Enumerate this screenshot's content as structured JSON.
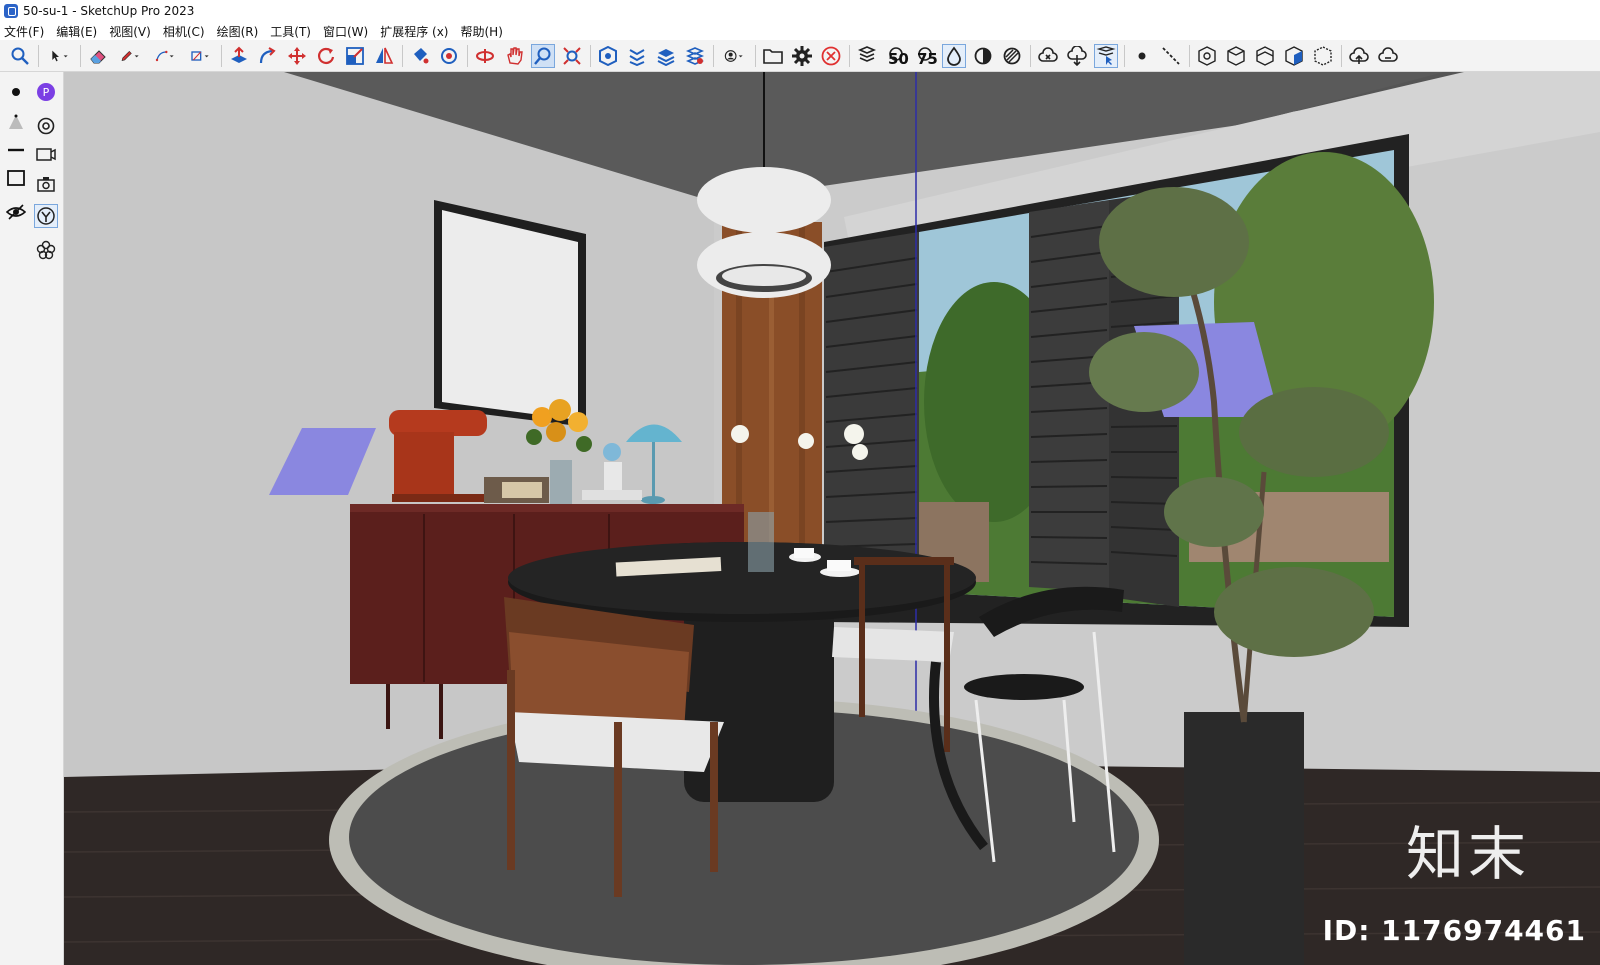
{
  "window": {
    "title": "50-su-1 - SketchUp Pro 2023"
  },
  "menu": [
    "文件(F)",
    "编辑(E)",
    "视图(V)",
    "相机(C)",
    "绘图(R)",
    "工具(T)",
    "窗口(W)",
    "扩展程序 (x)",
    "帮助(H)"
  ],
  "toolbar": {
    "badge_50": "50",
    "badge_75": "75"
  },
  "scene": {
    "brand_text": "知末",
    "id_text": "ID: 1176974461"
  },
  "colors": {
    "accent": "#2b63c7",
    "section_plane": "#8a87e0",
    "floor": "#2f2826",
    "wall": "#c9c9c9"
  }
}
